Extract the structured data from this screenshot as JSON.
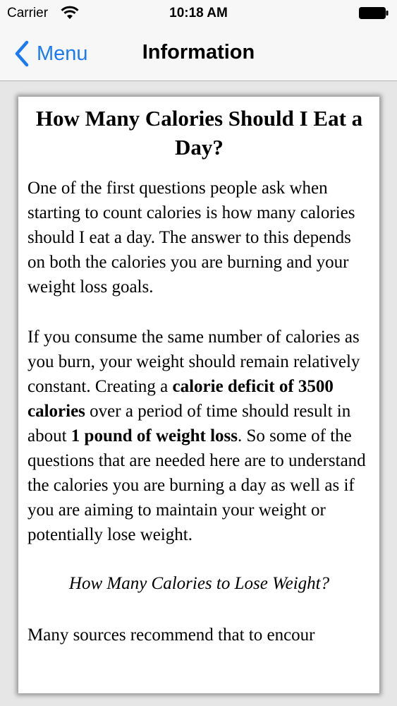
{
  "status_bar": {
    "carrier": "Carrier",
    "time": "10:18 AM",
    "wifi_icon": "wifi-icon",
    "battery_icon": "battery-icon"
  },
  "nav_bar": {
    "back_label": "Menu",
    "back_icon": "chevron-left-icon",
    "title": "Information",
    "accent_color": "#1a7bf2"
  },
  "article": {
    "title": "How Many Calories Should I Eat a Day?",
    "paragraph_1": "One of the first questions people ask when starting to count calories is how many calories should I eat a day. The answer to this depends on both the calories you are burning and your weight loss goals.",
    "paragraph_2": {
      "part_1": "If you consume the same number of calories as you burn, your weight should remain relatively constant. Creating a ",
      "bold_1": "calorie deficit of 3500 calories",
      "part_2": " over a period of time should result in about ",
      "bold_2": "1 pound of weight loss",
      "part_3": ". So some of the questions that are needed here are to understand the calories you are burning a day as well as if you are aiming to maintain your weight or potentially lose weight."
    },
    "subheading": "How Many Calories to Lose Weight?",
    "paragraph_3_partial": "Many sources recommend that to encour"
  }
}
